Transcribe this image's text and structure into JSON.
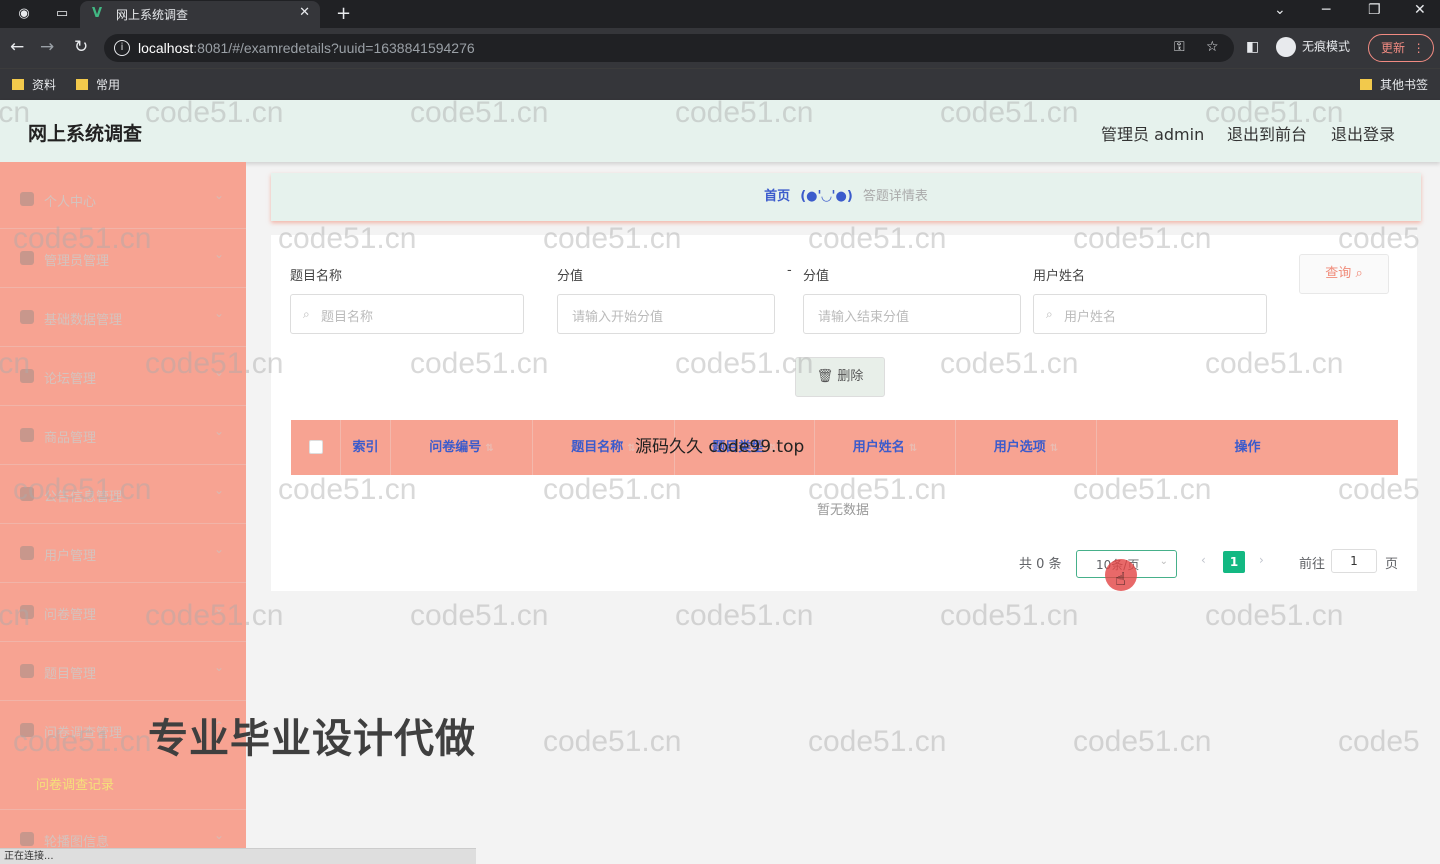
{
  "browser": {
    "tab_title": "网上系统调查",
    "new_tab": "+",
    "url_host": "localhost",
    "url_rest": ":8081/#/examredetails?uuid=1638841594276",
    "incognito_label": "无痕模式",
    "update_label": "更新",
    "bookmarks": [
      "资料",
      "常用"
    ],
    "other_bookmarks": "其他书签",
    "status_text": "正在连接..."
  },
  "header": {
    "title": "网上系统调查",
    "admin": "管理员 admin",
    "back_frontend": "退出到前台",
    "logout": "退出登录"
  },
  "sidebar": {
    "items": [
      {
        "label": "个人中心"
      },
      {
        "label": "管理员管理"
      },
      {
        "label": "基础数据管理"
      },
      {
        "label": "论坛管理"
      },
      {
        "label": "商品管理"
      },
      {
        "label": "公告信息管理"
      },
      {
        "label": "用户管理"
      },
      {
        "label": "问卷管理"
      },
      {
        "label": "题目管理"
      },
      {
        "label": "问卷调查管理"
      },
      {
        "label": "轮播图信息"
      }
    ],
    "submenu_active": "问卷调查记录"
  },
  "breadcrumb": {
    "home": "首页",
    "face": "(●'◡'●)",
    "current": "答题详情表"
  },
  "filters": {
    "title_label": "题目名称",
    "title_placeholder": "题目名称",
    "score_label": "分值",
    "score_start_placeholder": "请输入开始分值",
    "dash": "-",
    "score_end_label": "分值",
    "score_end_placeholder": "请输入结束分值",
    "user_label": "用户姓名",
    "user_placeholder": "用户姓名",
    "query_btn": "查询"
  },
  "actions": {
    "delete_btn": "删除"
  },
  "table": {
    "columns": [
      "索引",
      "问卷编号",
      "题目名称",
      "题目类型",
      "用户姓名",
      "用户选项",
      "操作"
    ],
    "empty_text": "暂无数据"
  },
  "pagination": {
    "total": "共 0 条",
    "page_size": "10条/页",
    "current_page": "1",
    "goto_label": "前往",
    "goto_value": "1",
    "goto_unit": "页"
  },
  "overlays": {
    "center_text": "源码久久 code99.top",
    "promo_text": "专业毕业设计代做",
    "watermark": "code51.cn"
  },
  "colors": {
    "sidebar": "#f7a392",
    "header": "#e6f2ed",
    "accent_blue": "#3b5bcc",
    "page_active": "#13b882"
  }
}
